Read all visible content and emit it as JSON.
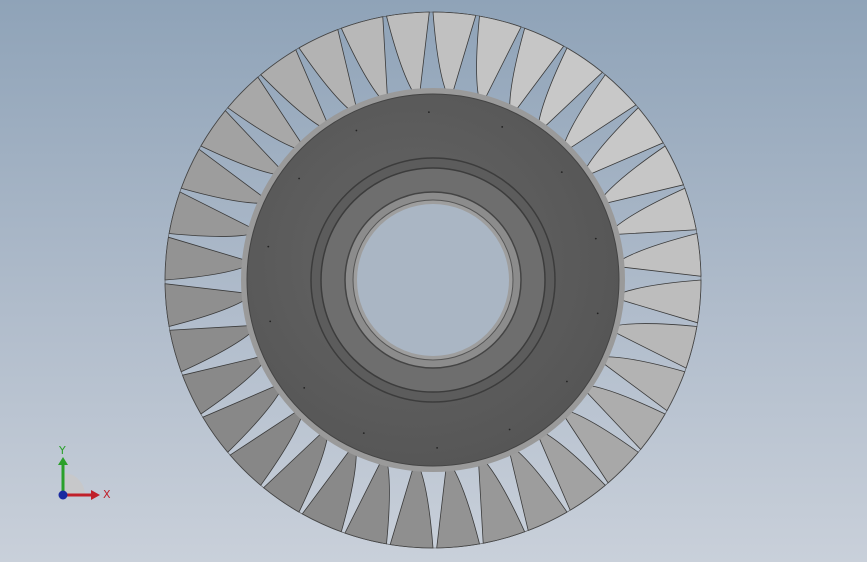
{
  "viewport": {
    "background_top": "#8fa3b8",
    "background_bottom": "#c9d0da"
  },
  "model": {
    "name": "turbine-wheel",
    "blade_count": 36,
    "blade_color_light": "#d4d4d4",
    "blade_color_dark": "#5e5e5e",
    "hub_color": "#5a5a5a",
    "hub_rim_color": "#8a8a8a",
    "bore_ring_color": "#6a6a6a",
    "bore_color": "#aab6c4"
  },
  "triad": {
    "x_label": "X",
    "y_label": "Y",
    "x_color": "#c0202a",
    "y_color": "#2aa02a",
    "z_color": "#1a2aa0"
  }
}
